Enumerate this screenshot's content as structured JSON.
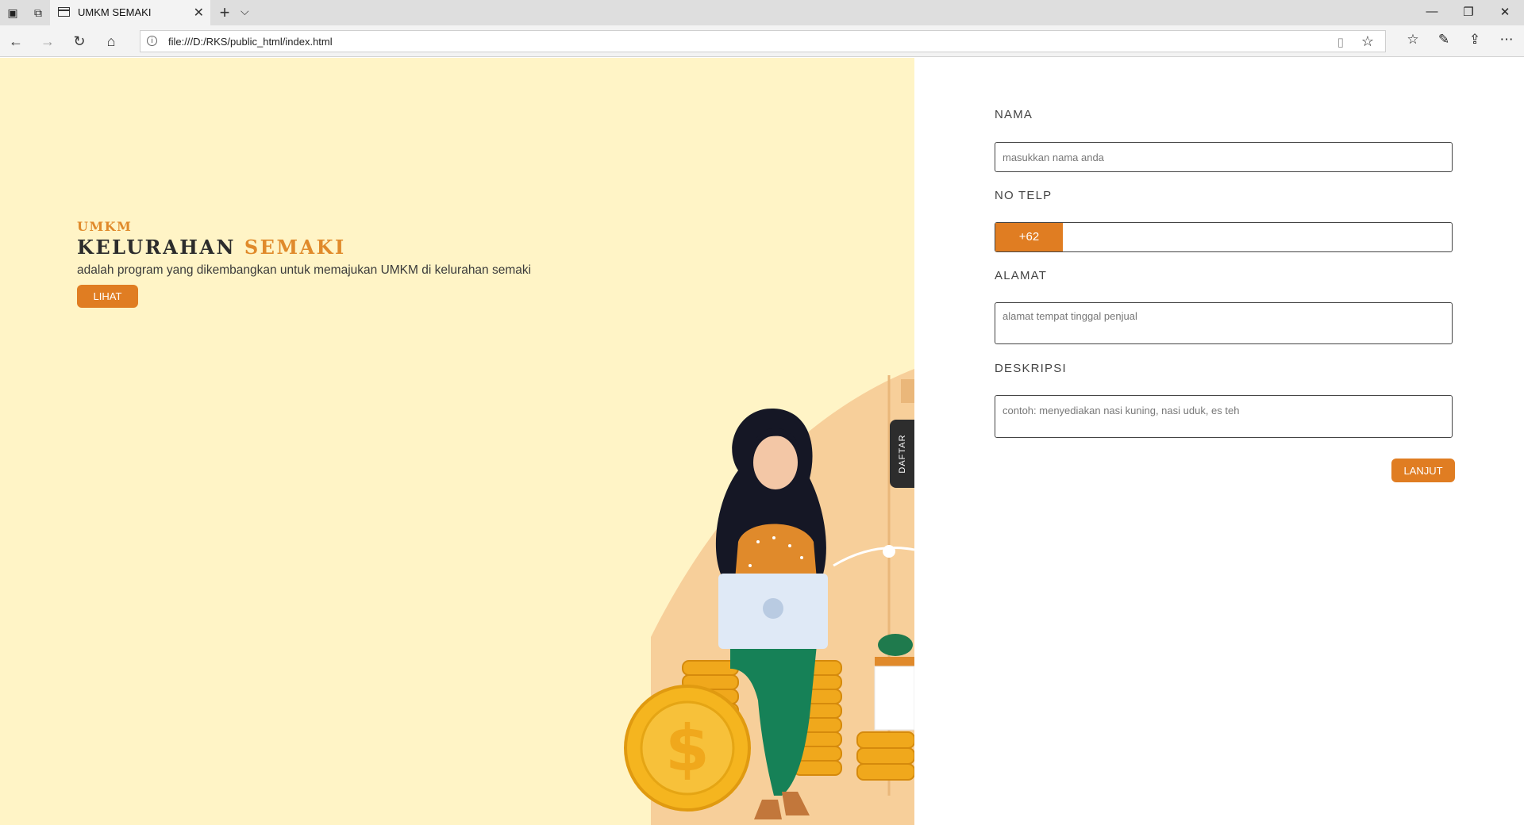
{
  "browser": {
    "tab_title": "UMKM SEMAKI",
    "url": "file:///D:/RKS/public_html/index.html",
    "icons": {
      "tab_actions": "tab-actions-icon",
      "set_aside": "set-aside-icon",
      "page": "page-icon",
      "close": "close-icon",
      "new_tab": "plus-icon",
      "tab_list": "chevron-down-icon",
      "back": "back-arrow-icon",
      "forward": "forward-arrow-icon",
      "refresh": "refresh-icon",
      "home": "home-icon",
      "info": "info-icon",
      "reading_view": "reading-view-icon",
      "favorite": "star-icon",
      "favorites_list": "favorites-list-icon",
      "notes": "pen-icon",
      "share": "share-icon",
      "more": "more-icon",
      "minimize": "minimize-icon",
      "restore": "restore-icon",
      "window_close": "window-close-icon"
    }
  },
  "hero": {
    "kicker": "UMKM",
    "title_main": "KELURAHAN",
    "title_accent": "SEMAKI",
    "description": "adalah program yang dikembangkan untuk memajukan UMKM di kelurahan semaki",
    "button_label": "LIHAT"
  },
  "side_tab": {
    "label": "DAFTAR"
  },
  "form": {
    "nama": {
      "label": "NAMA",
      "placeholder": "masukkan nama anda"
    },
    "telp": {
      "label": "NO TELP",
      "prefix": "+62",
      "value": ""
    },
    "alamat": {
      "label": "ALAMAT",
      "placeholder": "alamat tempat tinggal penjual"
    },
    "deskripsi": {
      "label": "DESKRIPSI",
      "placeholder": "contoh: menyediakan nasi kuning, nasi uduk, es teh"
    },
    "submit_label": "LANJUT"
  },
  "colors": {
    "accent": "#e07d22",
    "hero_bg": "#fff4c6",
    "dark": "#2c2c2c"
  }
}
